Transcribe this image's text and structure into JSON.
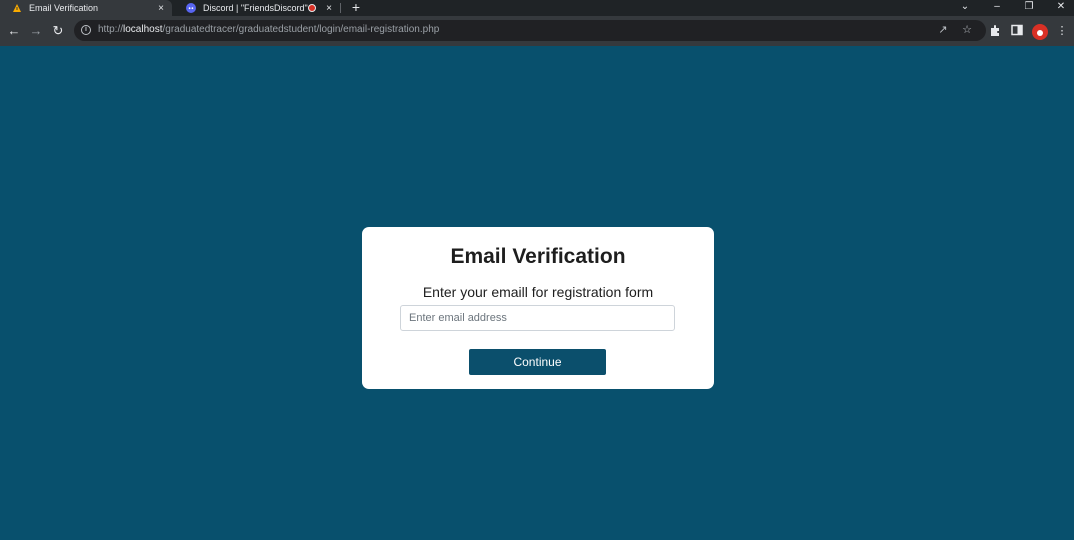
{
  "browser": {
    "tabs": [
      {
        "title": "Email Verification",
        "close": "×",
        "active": true,
        "favicon": "lock-warning-icon"
      },
      {
        "title": "Discord | \"FriendsDiscord\" | /",
        "close": "×",
        "active": false,
        "favicon": "discord-icon"
      }
    ],
    "new_tab": "+",
    "address": {
      "scheme": "http://",
      "host": "localhost",
      "path": "/graduatedtracer/graduatedstudent/login/email-registration.php"
    }
  },
  "card": {
    "title": "Email Verification",
    "subtitle": "Enter your emaill for registration form",
    "email_placeholder": "Enter email address",
    "email_value": "",
    "continue_label": "Continue"
  },
  "colors": {
    "page_background": "#08506d",
    "button_background": "#0b4f6c",
    "card_background": "#ffffff"
  }
}
